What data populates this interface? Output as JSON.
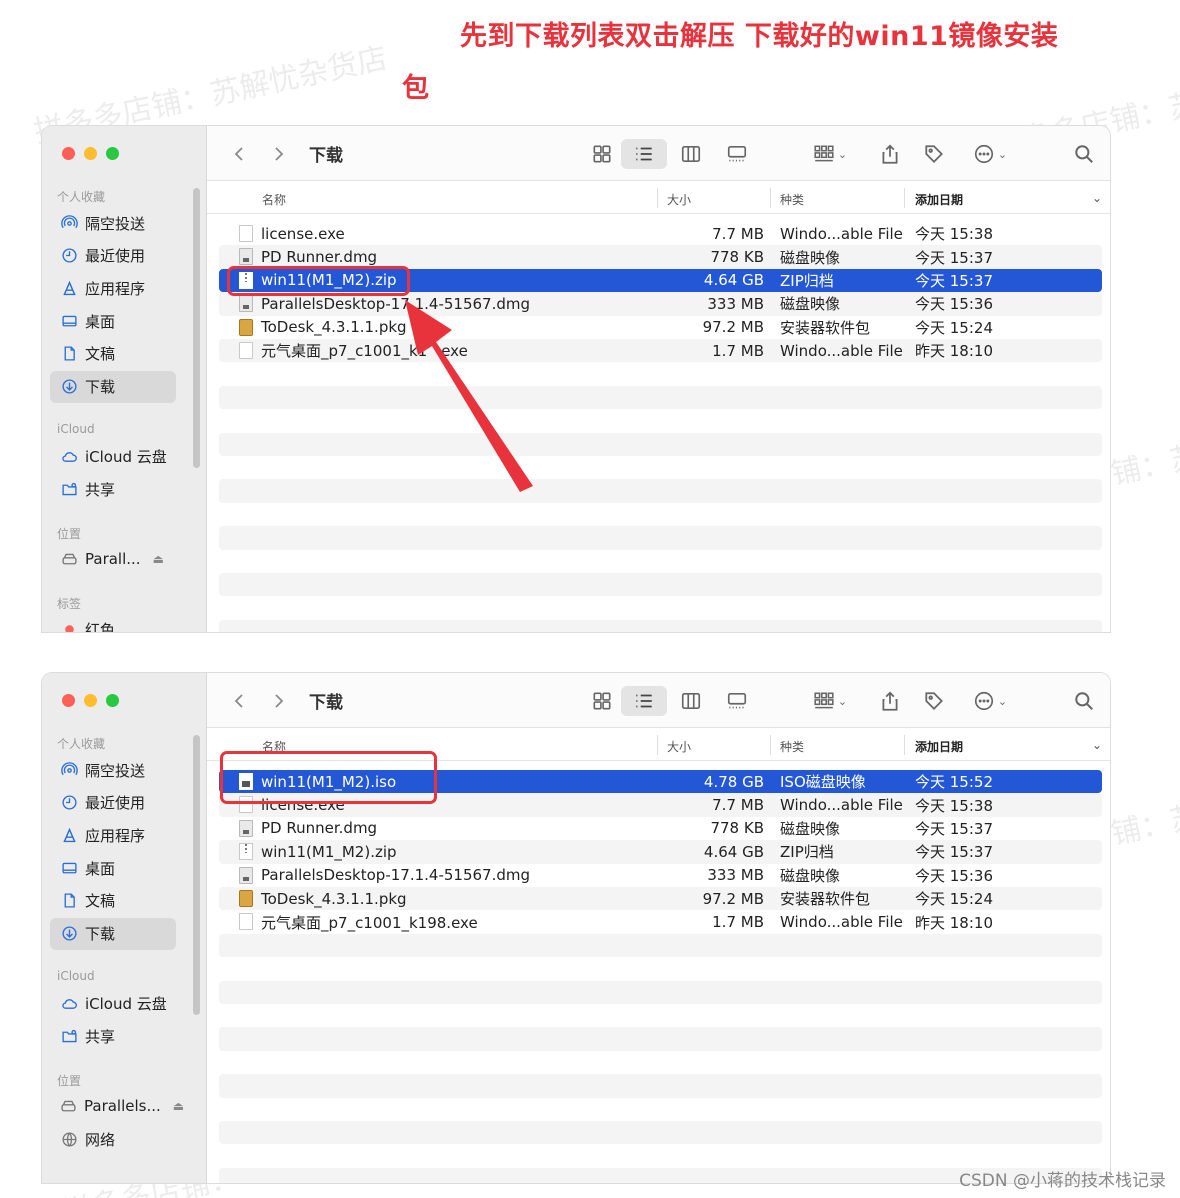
{
  "caption": {
    "line1": "先到下载列表双击解压 下载好的win11镜像安装",
    "line2": "包"
  },
  "watermark": {
    "text1": "拼多多店铺：苏解忧杂货店",
    "text2": "拼多多店铺：苏",
    "text3": "铺：苏",
    "text4": "铺：苏",
    "text5": "拼多多店铺："
  },
  "footer_credit": "CSDN @小蒋的技术栈记录",
  "colors": {
    "selection": "#2457d6",
    "annotation": "#e8323c",
    "sidebar_icon": "#2a6fd6"
  },
  "window1": {
    "title": "下载",
    "sidebar": {
      "favorites_label": "个人收藏",
      "favorites": [
        "隔空投送",
        "最近使用",
        "应用程序",
        "桌面",
        "文稿",
        "下载"
      ],
      "icloud_label": "iCloud",
      "icloud": [
        "iCloud 云盘",
        "共享"
      ],
      "locations_label": "位置",
      "locations": [
        "Parall..."
      ],
      "tags_label": "标签",
      "tags": [
        "红色"
      ]
    },
    "columns": {
      "name": "名称",
      "size": "大小",
      "kind": "种类",
      "date": "添加日期"
    },
    "files": [
      {
        "name": "license.exe",
        "size": "7.7 MB",
        "kind": "Windo...able File",
        "date": "今天 15:38",
        "icon": "doc"
      },
      {
        "name": "PD Runner.dmg",
        "size": "778 KB",
        "kind": "磁盘映像",
        "date": "今天 15:37",
        "icon": "disk"
      },
      {
        "name": "win11(M1_M2).zip",
        "size": "4.64 GB",
        "kind": "ZIP归档",
        "date": "今天 15:37",
        "icon": "zip",
        "selected": true
      },
      {
        "name": "ParallelsDesktop-17.1.4-51567.dmg",
        "size": "333 MB",
        "kind": "磁盘映像",
        "date": "今天 15:36",
        "icon": "disk"
      },
      {
        "name": "ToDesk_4.3.1.1.pkg",
        "size": "97.2 MB",
        "kind": "安装器软件包",
        "date": "今天 15:24",
        "icon": "pkg"
      },
      {
        "name": "元气桌面_p7_c1001_k1",
        "name_tail": "exe",
        "size": "1.7 MB",
        "kind": "Windo...able File",
        "date": "昨天 18:10",
        "icon": "doc"
      }
    ]
  },
  "window2": {
    "title": "下载",
    "sidebar": {
      "favorites_label": "个人收藏",
      "favorites": [
        "隔空投送",
        "最近使用",
        "应用程序",
        "桌面",
        "文稿",
        "下载"
      ],
      "icloud_label": "iCloud",
      "icloud": [
        "iCloud 云盘",
        "共享"
      ],
      "locations_label": "位置",
      "locations": [
        "Parallels...",
        "网络"
      ]
    },
    "columns": {
      "name": "名称",
      "size": "大小",
      "kind": "种类",
      "date": "添加日期"
    },
    "files": [
      {
        "name": "win11(M1_M2).iso",
        "size": "4.78 GB",
        "kind": "ISO磁盘映像",
        "date": "今天 15:52",
        "icon": "iso",
        "selected": true
      },
      {
        "name": "license.exe",
        "size": "7.7 MB",
        "kind": "Windo...able File",
        "date": "今天 15:38",
        "icon": "doc"
      },
      {
        "name": "PD Runner.dmg",
        "size": "778 KB",
        "kind": "磁盘映像",
        "date": "今天 15:37",
        "icon": "disk"
      },
      {
        "name": "win11(M1_M2).zip",
        "size": "4.64 GB",
        "kind": "ZIP归档",
        "date": "今天 15:37",
        "icon": "zip"
      },
      {
        "name": "ParallelsDesktop-17.1.4-51567.dmg",
        "size": "333 MB",
        "kind": "磁盘映像",
        "date": "今天 15:36",
        "icon": "disk"
      },
      {
        "name": "ToDesk_4.3.1.1.pkg",
        "size": "97.2 MB",
        "kind": "安装器软件包",
        "date": "今天 15:24",
        "icon": "pkg"
      },
      {
        "name": "元气桌面_p7_c1001_k198.exe",
        "size": "1.7 MB",
        "kind": "Windo...able File",
        "date": "昨天 18:10",
        "icon": "doc"
      }
    ]
  }
}
